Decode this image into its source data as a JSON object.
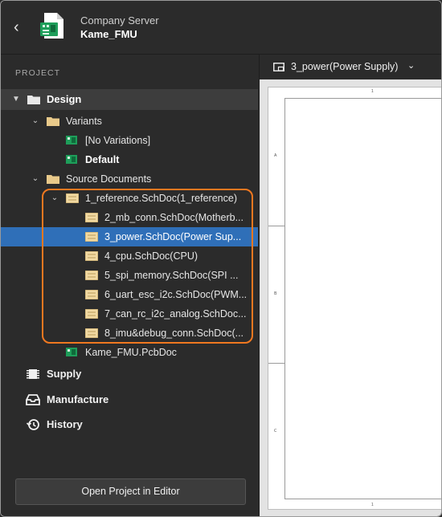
{
  "header": {
    "subtitle": "Company Server",
    "title": "Kame_FMU",
    "back_icon": "chevron-left-icon",
    "project_icon": "board-project-icon"
  },
  "panel": {
    "section_label": "PROJECT",
    "design": "Design",
    "variants": "Variants",
    "variant_items": [
      "[No Variations]",
      "Default"
    ],
    "source_documents": "Source Documents",
    "root_doc": "1_reference.SchDoc(1_reference)",
    "child_docs": [
      "2_mb_conn.SchDoc(Motherb...",
      "3_power.SchDoc(Power Sup...",
      "4_cpu.SchDoc(CPU)",
      "5_spi_memory.SchDoc(SPI ...",
      "6_uart_esc_i2c.SchDoc(PWM...",
      "7_can_rc_i2c_analog.SchDoc...",
      "8_imu&debug_conn.SchDoc(..."
    ],
    "pcb_doc": "Kame_FMU.PcbDoc",
    "nav": [
      "Supply",
      "Manufacture",
      "History"
    ],
    "open_button": "Open Project in Editor"
  },
  "viewer": {
    "tab_label": "3_power(Power Supply)",
    "zone_labels": [
      "A",
      "B",
      "C"
    ],
    "column_mark": "1"
  },
  "colors": {
    "selection": "#2f6fb8",
    "highlight": "#f07820",
    "background": "#2b2b2b"
  }
}
